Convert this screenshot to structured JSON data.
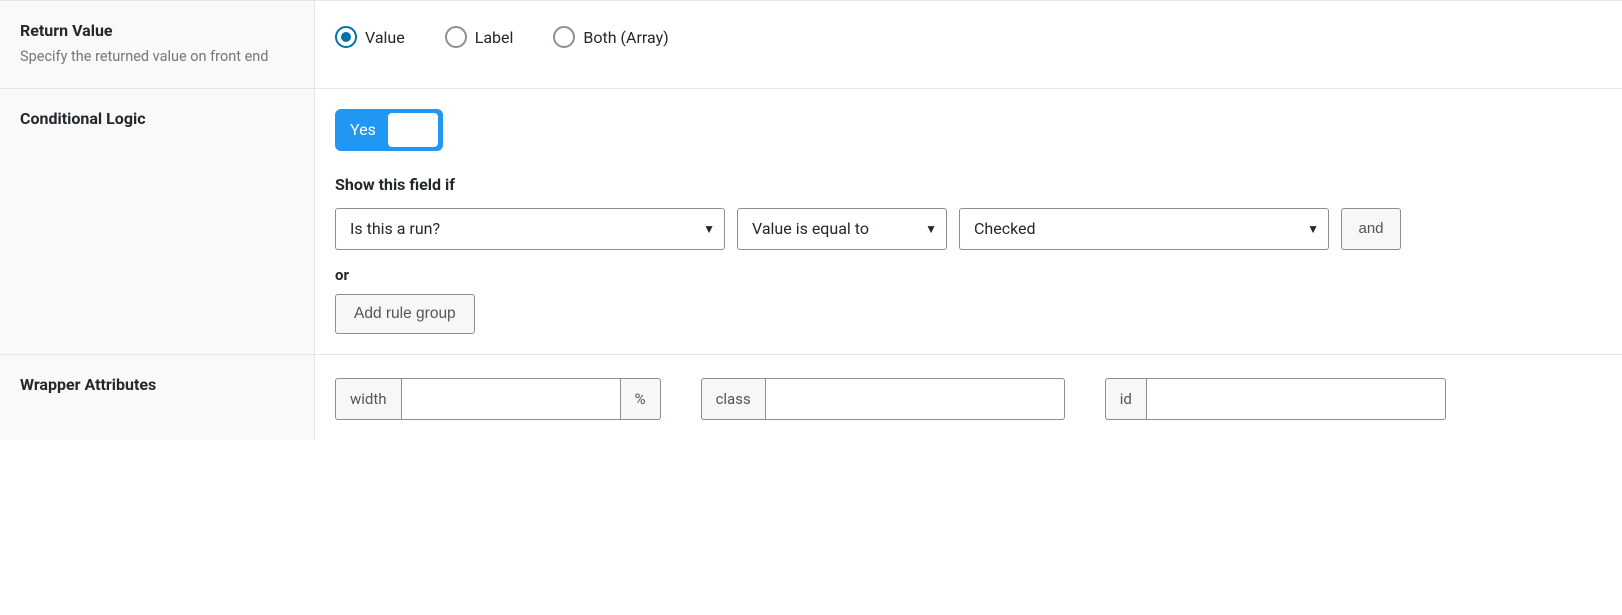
{
  "returnValue": {
    "title": "Return Value",
    "description": "Specify the returned value on front end",
    "options": {
      "value": "Value",
      "label": "Label",
      "both": "Both (Array)"
    },
    "selected": "value"
  },
  "conditionalLogic": {
    "title": "Conditional Logic",
    "toggle": {
      "label": "Yes",
      "on": true
    },
    "showIfLabel": "Show this field if",
    "rules": [
      {
        "field": "Is this a run?",
        "operator": "Value is equal to",
        "value": "Checked"
      }
    ],
    "andLabel": "and",
    "orLabel": "or",
    "addGroupLabel": "Add rule group"
  },
  "wrapperAttributes": {
    "title": "Wrapper Attributes",
    "width": {
      "prefix": "width",
      "value": "",
      "suffix": "%"
    },
    "class": {
      "prefix": "class",
      "value": ""
    },
    "id": {
      "prefix": "id",
      "value": ""
    }
  }
}
